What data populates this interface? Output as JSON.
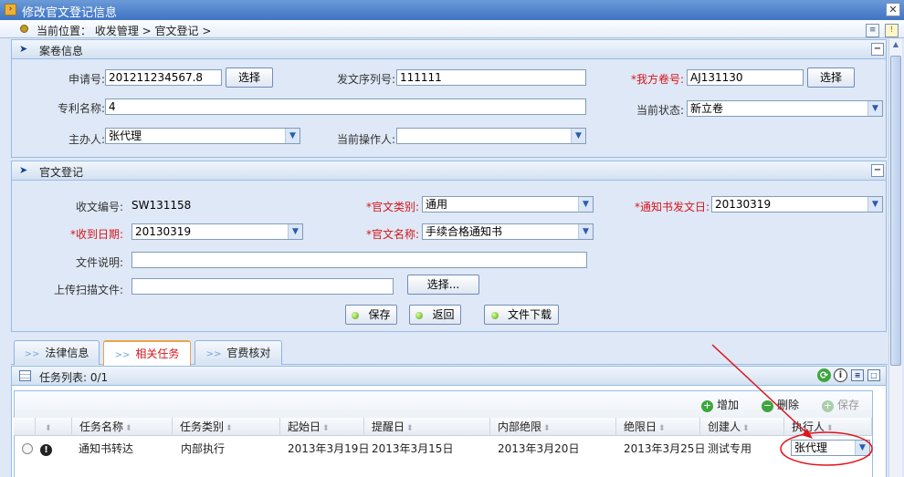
{
  "window": {
    "title": "修改官文登记信息"
  },
  "breadcrumb": {
    "text": "当前位置： 收发管理 > 官文登记 >"
  },
  "case_panel": {
    "title": "案卷信息",
    "application_no_label": "申请号:",
    "application_no_value": "201211234567.8",
    "select_label": "选择",
    "serial_label": "发文序列号:",
    "serial_value": "111111",
    "our_case_label": "*我方卷号:",
    "our_case_value": "AJ131130",
    "patent_name_label": "专利名称:",
    "patent_name_value": "4",
    "status_label": "当前状态:",
    "status_value": "新立卷",
    "host_label": "主办人:",
    "host_value": "张代理",
    "operator_label": "当前操作人:",
    "operator_value": ""
  },
  "official_panel": {
    "title": "官文登记",
    "receipt_no_label": "收文编号:",
    "receipt_no_value": "SW131158",
    "doc_type_label": "*官文类别:",
    "doc_type_value": "通用",
    "notice_date_label": "*通知书发文日:",
    "notice_date_value": "20130319",
    "received_date_label": "*收到日期:",
    "received_date_value": "20130319",
    "doc_name_label": "*官文名称:",
    "doc_name_value": "手续合格通知书",
    "file_desc_label": "文件说明:",
    "file_desc_value": "",
    "upload_label": "上传扫描文件:",
    "upload_value": "",
    "browse_label": "选择...",
    "save_label": "保存",
    "back_label": "返回",
    "download_label": "文件下载"
  },
  "tabs": [
    {
      "label": "法律信息"
    },
    {
      "label": "相关任务"
    },
    {
      "label": "官费核对"
    }
  ],
  "task_list": {
    "title": "任务列表: 0/1",
    "add_label": "增加",
    "delete_label": "删除",
    "save_label": "保存",
    "columns": [
      "任务名称",
      "任务类别",
      "起始日",
      "提醒日",
      "内部绝限",
      "绝限日",
      "创建人",
      "执行人"
    ],
    "rows": [
      {
        "name": "通知书转达",
        "category": "内部执行",
        "start": "2013年3月19日",
        "remind": "2013年3月15日",
        "internal_deadline": "2013年3月20日",
        "deadline": "2013年3月25日",
        "creator": "测试专用",
        "executor": "张代理"
      }
    ]
  },
  "colors": {
    "required": "#d4161b",
    "panel_border": "#99bbe8",
    "annotation": "#e0141b"
  }
}
